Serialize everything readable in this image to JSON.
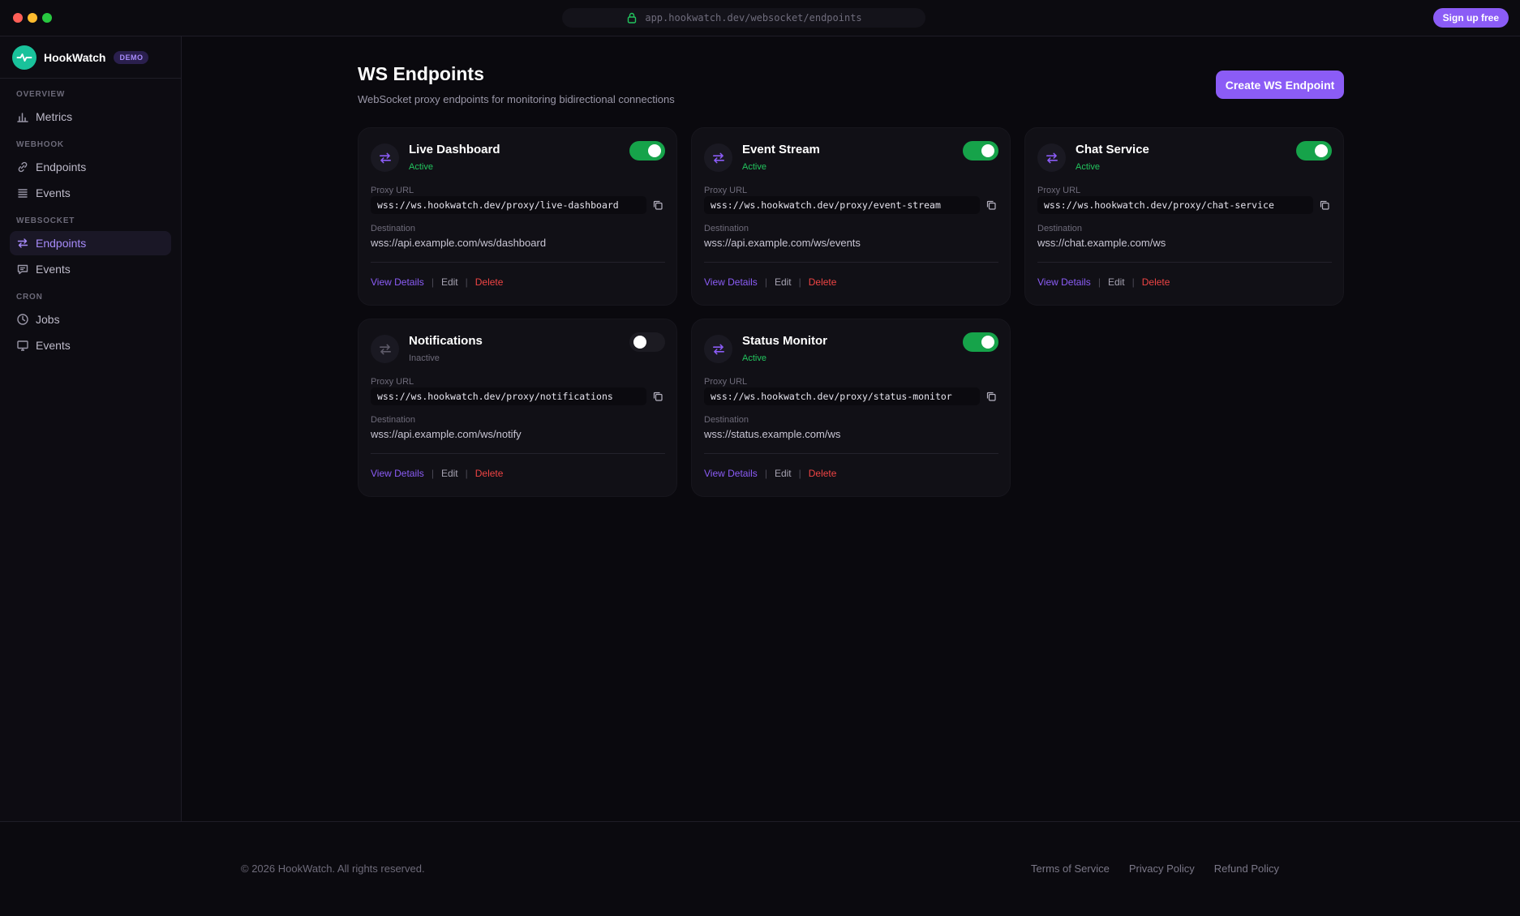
{
  "browser": {
    "url": "app.hookwatch.dev/websocket/endpoints",
    "signup_label": "Sign up free"
  },
  "brand": {
    "name": "HookWatch",
    "badge": "DEMO",
    "accent": "#8b5cf6",
    "logo_color": "#19c29b"
  },
  "sidebar": {
    "sections": [
      {
        "label": "OVERVIEW",
        "items": [
          {
            "label": "Metrics",
            "icon": "bar-chart-icon",
            "active": false
          }
        ]
      },
      {
        "label": "WEBHOOK",
        "items": [
          {
            "label": "Endpoints",
            "icon": "link-icon",
            "active": false
          },
          {
            "label": "Events",
            "icon": "list-icon",
            "active": false
          }
        ]
      },
      {
        "label": "WEBSOCKET",
        "items": [
          {
            "label": "Endpoints",
            "icon": "arrows-swap-icon",
            "active": true
          },
          {
            "label": "Events",
            "icon": "message-icon",
            "active": false
          }
        ]
      },
      {
        "label": "CRON",
        "items": [
          {
            "label": "Jobs",
            "icon": "clock-icon",
            "active": false
          },
          {
            "label": "Events",
            "icon": "monitor-icon",
            "active": false
          }
        ]
      }
    ]
  },
  "header": {
    "title": "WS Endpoints",
    "subtitle": "WebSocket proxy endpoints for monitoring bidirectional connections",
    "create_label": "Create WS Endpoint"
  },
  "card_labels": {
    "proxy_url": "Proxy URL",
    "destination": "Destination",
    "view_details": "View Details",
    "edit": "Edit",
    "delete": "Delete"
  },
  "endpoints": [
    {
      "name": "Live Dashboard",
      "status": "Active",
      "enabled": true,
      "proxy_url": "wss://ws.hookwatch.dev/proxy/live-dashboard",
      "destination": "wss://api.example.com/ws/dashboard"
    },
    {
      "name": "Event Stream",
      "status": "Active",
      "enabled": true,
      "proxy_url": "wss://ws.hookwatch.dev/proxy/event-stream",
      "destination": "wss://api.example.com/ws/events"
    },
    {
      "name": "Chat Service",
      "status": "Active",
      "enabled": true,
      "proxy_url": "wss://ws.hookwatch.dev/proxy/chat-service",
      "destination": "wss://chat.example.com/ws"
    },
    {
      "name": "Notifications",
      "status": "Inactive",
      "enabled": false,
      "proxy_url": "wss://ws.hookwatch.dev/proxy/notifications",
      "destination": "wss://api.example.com/ws/notify"
    },
    {
      "name": "Status Monitor",
      "status": "Active",
      "enabled": true,
      "proxy_url": "wss://ws.hookwatch.dev/proxy/status-monitor",
      "destination": "wss://status.example.com/ws"
    }
  ],
  "footer": {
    "copyright": "© 2026 HookWatch. All rights reserved.",
    "links": [
      "Terms of Service",
      "Privacy Policy",
      "Refund Policy"
    ]
  }
}
